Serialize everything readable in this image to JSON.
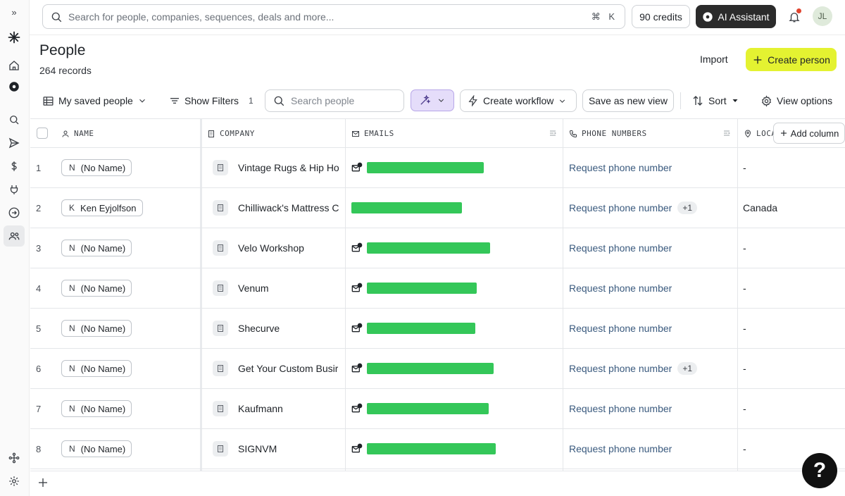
{
  "rail": {
    "expand": "»",
    "items": [
      "logo",
      "home",
      "dashboard",
      "search",
      "sequences",
      "deals",
      "tasks",
      "enrichment",
      "people"
    ],
    "bottom": [
      "integrations",
      "settings"
    ]
  },
  "topbar": {
    "search_placeholder": "Search for people, companies, sequences, deals and more...",
    "shortcut": "⌘ K",
    "credits": "90 credits",
    "ai_assistant": "AI Assistant",
    "avatar_initials": "JL"
  },
  "header": {
    "title": "People",
    "records": "264 records",
    "import": "Import",
    "create_person": "Create person"
  },
  "toolbar": {
    "saved_view": "My saved people",
    "show_filters": "Show Filters",
    "filters_count": "1",
    "search_placeholder": "Search people",
    "create_workflow": "Create workflow",
    "save_view": "Save as new view",
    "sort": "Sort",
    "view_options": "View options"
  },
  "table": {
    "columns": {
      "name": "NAME",
      "company": "COMPANY",
      "emails": "EMAILS",
      "phone": "PHONE NUMBERS",
      "location": "LOCA",
      "add_column": "Add column"
    },
    "rows": [
      {
        "num": "1",
        "initial": "N",
        "name": "(No Name)",
        "company": "Vintage Rugs & Hip Ho",
        "phone": "Request phone number",
        "extra": "",
        "location": "-"
      },
      {
        "num": "2",
        "initial": "K",
        "name": "Ken Eyjolfson",
        "company": "Chilliwack's Mattress C",
        "phone": "Request phone number",
        "extra": "+1",
        "location": "Canada"
      },
      {
        "num": "3",
        "initial": "N",
        "name": "(No Name)",
        "company": "Velo Workshop",
        "phone": "Request phone number",
        "extra": "",
        "location": "-"
      },
      {
        "num": "4",
        "initial": "N",
        "name": "(No Name)",
        "company": "Venum",
        "phone": "Request phone number",
        "extra": "",
        "location": "-"
      },
      {
        "num": "5",
        "initial": "N",
        "name": "(No Name)",
        "company": "Shecurve",
        "phone": "Request phone number",
        "extra": "",
        "location": "-"
      },
      {
        "num": "6",
        "initial": "N",
        "name": "(No Name)",
        "company": "Get Your Custom Busir",
        "phone": "Request phone number",
        "extra": "+1",
        "location": "-"
      },
      {
        "num": "7",
        "initial": "N",
        "name": "(No Name)",
        "company": "Kaufmann",
        "phone": "Request phone number",
        "extra": "",
        "location": "-"
      },
      {
        "num": "8",
        "initial": "N",
        "name": "(No Name)",
        "company": "SIGNVM",
        "phone": "Request phone number",
        "extra": "",
        "location": "-"
      }
    ]
  },
  "help": "?",
  "colors": {
    "accent_create": "#e4f231",
    "redaction": "#34c759",
    "phone_link": "#3a5a7e"
  }
}
